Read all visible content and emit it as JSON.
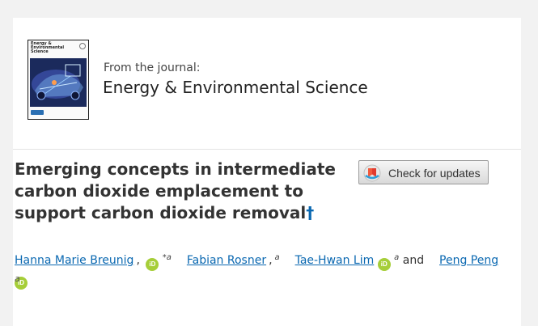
{
  "journal": {
    "kicker": "From the journal:",
    "name": "Energy & Environmental Science",
    "cover_title": "Energy &\nEnvironmental\nScience"
  },
  "article": {
    "title": "Emerging concepts in intermediate carbon dioxide emplacement to support carbon dioxide removal",
    "dagger": "†"
  },
  "check_updates": {
    "label": "Check for updates",
    "icon": "crossmark-icon"
  },
  "authors": [
    {
      "name": "Hanna Marie Breunig",
      "orcid_icon": "orcid-icon",
      "marks": "*a"
    },
    {
      "name": "Fabian Rosner",
      "marks": "a"
    },
    {
      "name": "Tae-Hwan Lim",
      "orcid_icon": "orcid-icon",
      "marks": "a"
    },
    {
      "name": "Peng Peng",
      "orcid_icon": "orcid-icon",
      "marks": ""
    }
  ],
  "authors_and": "and",
  "affiliation_mark": "a",
  "orcid_text": "iD",
  "colors": {
    "link": "#0a68b1",
    "orcid": "#a6ce39",
    "background": "#f2f2f2"
  }
}
